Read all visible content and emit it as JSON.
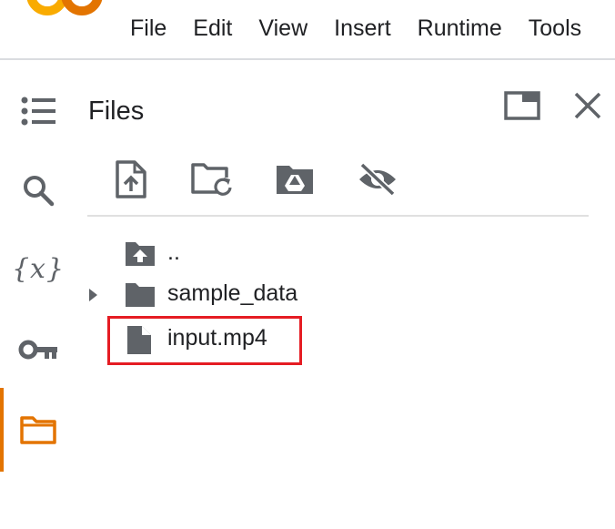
{
  "menu": {
    "items": [
      "File",
      "Edit",
      "View",
      "Insert",
      "Runtime",
      "Tools"
    ]
  },
  "rail": {
    "items": [
      {
        "name": "table-of-contents",
        "icon": "list-icon",
        "active": false
      },
      {
        "name": "search",
        "icon": "search-icon",
        "active": false
      },
      {
        "name": "variables",
        "icon": "variables-icon",
        "glyph": "{x}",
        "active": false
      },
      {
        "name": "secrets",
        "icon": "key-icon",
        "active": false
      },
      {
        "name": "files",
        "icon": "folder-icon",
        "active": true
      }
    ]
  },
  "panel": {
    "title": "Files",
    "header_actions": [
      {
        "name": "move-to-tab",
        "icon": "window-icon"
      },
      {
        "name": "close",
        "icon": "close-icon"
      }
    ],
    "toolbar": [
      {
        "name": "upload",
        "icon": "upload-file-icon"
      },
      {
        "name": "refresh",
        "icon": "folder-refresh-icon"
      },
      {
        "name": "mount-drive",
        "icon": "drive-folder-icon"
      },
      {
        "name": "toggle-hidden",
        "icon": "visibility-off-icon"
      }
    ],
    "tree": [
      {
        "label": "..",
        "icon": "parent-folder-icon",
        "expandable": false
      },
      {
        "label": "sample_data",
        "icon": "folder-icon",
        "expandable": true
      },
      {
        "label": "input.mp4",
        "icon": "file-icon",
        "expandable": false,
        "highlighted": true
      }
    ]
  },
  "colors": {
    "accent": "#e37400",
    "icon_gray": "#5f6368",
    "highlight_border": "#e51c23",
    "divider": "#dadce0"
  }
}
